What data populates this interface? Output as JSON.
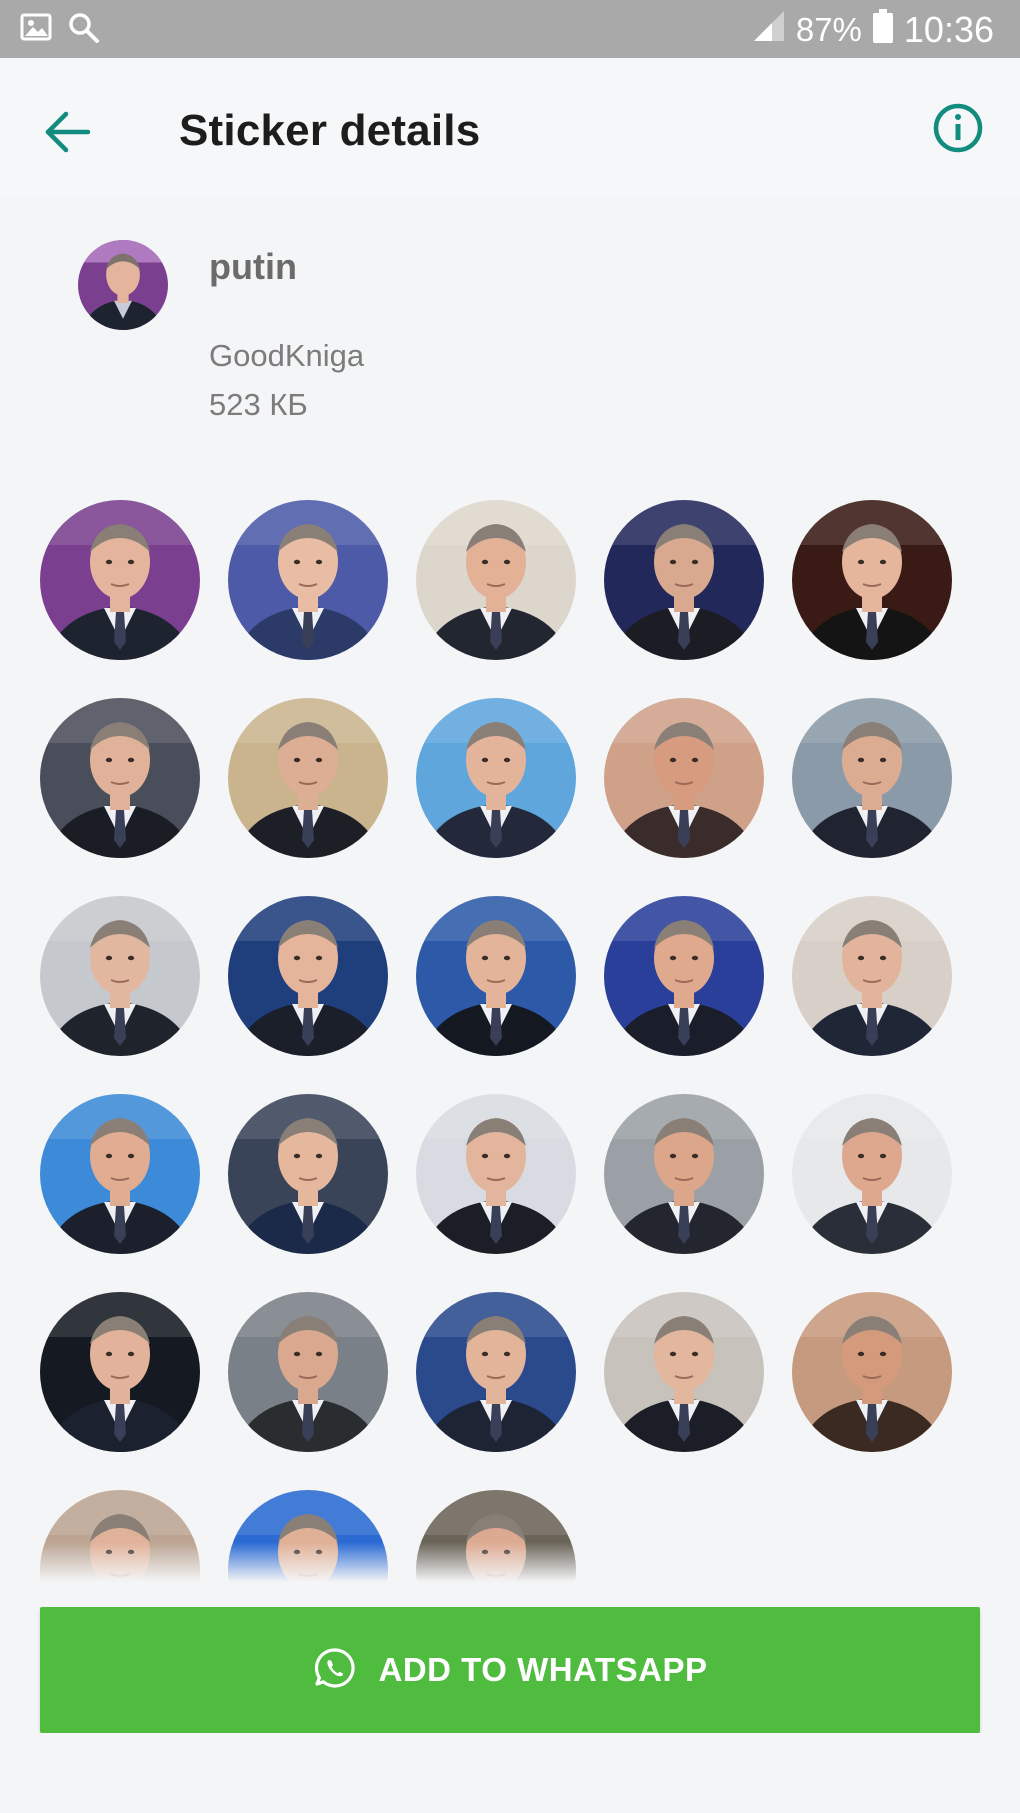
{
  "status_bar": {
    "battery_percent": "87%",
    "time": "10:36",
    "icons": [
      "gallery-icon",
      "search-icon",
      "signal-icon",
      "battery-icon"
    ]
  },
  "app_bar": {
    "title": "Sticker details",
    "back_icon": "arrow-back-icon",
    "info_icon": "info-icon",
    "accent_color": "#128c7e"
  },
  "pack": {
    "name": "putin",
    "publisher": "GoodKniga",
    "size": "523 КБ"
  },
  "stickers": [
    {
      "bg": "#7a3f8f",
      "skin": "#e4b59c",
      "suit": "#1e2330"
    },
    {
      "bg": "#4d5aa8",
      "skin": "#e8bda4",
      "suit": "#2b3a66"
    },
    {
      "bg": "#ddd6cc",
      "skin": "#e2b196",
      "suit": "#222630"
    },
    {
      "bg": "#23285a",
      "skin": "#d8a98f",
      "suit": "#1c1c24"
    },
    {
      "bg": "#3a1a14",
      "skin": "#e6b69c",
      "suit": "#141414"
    },
    {
      "bg": "#4a4e5a",
      "skin": "#e1b29a",
      "suit": "#1a1d24"
    },
    {
      "bg": "#c9b48e",
      "skin": "#dcae94",
      "suit": "#1d1f26"
    },
    {
      "bg": "#5ea6dc",
      "skin": "#e3b49a",
      "suit": "#23293a"
    },
    {
      "bg": "#cfa189",
      "skin": "#d79c80",
      "suit": "#3a2c2a"
    },
    {
      "bg": "#8a9aa8",
      "skin": "#dcac92",
      "suit": "#202430"
    },
    {
      "bg": "#c5c8cc",
      "skin": "#e2b7a0",
      "suit": "#1f232c"
    },
    {
      "bg": "#1f3e7c",
      "skin": "#e4b59b",
      "suit": "#1b1f2a"
    },
    {
      "bg": "#2d5aa8",
      "skin": "#e3b39a",
      "suit": "#141820"
    },
    {
      "bg": "#2a3f9a",
      "skin": "#dfa98e",
      "suit": "#1a1e2a"
    },
    {
      "bg": "#d8d0c8",
      "skin": "#e2b49c",
      "suit": "#1f2636"
    },
    {
      "bg": "#3d8ad8",
      "skin": "#e0ad92",
      "suit": "#1b202c"
    },
    {
      "bg": "#3a4458",
      "skin": "#e5b89e",
      "suit": "#1c2a4a"
    },
    {
      "bg": "#d8dce2",
      "skin": "#e3b59d",
      "suit": "#1b1e26"
    },
    {
      "bg": "#9aa0a6",
      "skin": "#dca68a",
      "suit": "#23262e"
    },
    {
      "bg": "#e6e8ea",
      "skin": "#dda88e",
      "suit": "#2a2e38"
    },
    {
      "bg": "#151a22",
      "skin": "#e2b39a",
      "suit": "#1c2130"
    },
    {
      "bg": "#7a8088",
      "skin": "#d9a88e",
      "suit": "#2a2d30"
    },
    {
      "bg": "#2b4a8c",
      "skin": "#e2b49a",
      "suit": "#1d2434"
    },
    {
      "bg": "#c8c2bc",
      "skin": "#e3b69e",
      "suit": "#1b1e26"
    },
    {
      "bg": "#c69a7e",
      "skin": "#d39a7c",
      "suit": "#3a2a22"
    },
    {
      "bg": "#bba492",
      "skin": "#e1b29a",
      "suit": "#1e2028"
    },
    {
      "bg": "#2a6ad2",
      "skin": "#e0b096",
      "suit": "#1c2130"
    },
    {
      "bg": "#6a6458",
      "skin": "#dcaa90",
      "suit": "#1b1d24"
    }
  ],
  "add_button": {
    "label": "ADD TO WHATSAPP",
    "icon": "whatsapp-icon",
    "color": "#4fbb3f"
  }
}
